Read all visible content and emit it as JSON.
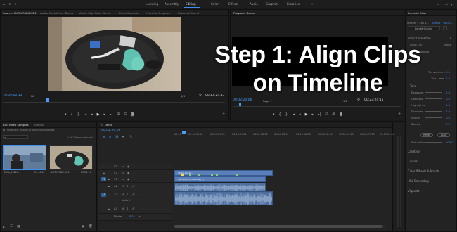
{
  "workspaces": {
    "tabs": [
      "Learning",
      "Assembly",
      "Editing",
      "Color",
      "Effects",
      "Audio",
      "Graphics",
      "Libraries"
    ],
    "active": "Editing"
  },
  "source_panel": {
    "tabs": [
      "Source: 4NT8478DK.MP4",
      "Audio Track Mixer: Demo",
      "Audio Clip Mixer: Demo",
      "Effect Controls",
      "Essential Graphics",
      "Essential Sound"
    ],
    "timecode_left": "16:59:00:13",
    "fit": "Fit",
    "timecode_right": "00:23:24:15",
    "scale": "1/8"
  },
  "program_panel": {
    "tab": "Program: Demo",
    "timecode_left": "00:02:20:06",
    "page": "Page 1",
    "fraction": "1/2",
    "timecode_right": "00:23:24:15"
  },
  "overlay": {
    "line1": "Step 1: Align Clips",
    "line2": "on Timeline"
  },
  "lumetri": {
    "title": "Lumetri Color",
    "master": "Master * 4NT8...",
    "sequence": "Demo * 4NT8...",
    "preset": "Lumetri Color",
    "basic_correction": "Basic Correction",
    "input_lut": "Input LUT",
    "input_lut_value": "None",
    "white_balance": "White Balance",
    "tone": "Tone",
    "rows": [
      {
        "label": "Temperature",
        "value": "0.0"
      },
      {
        "label": "Tint",
        "value": "0.0"
      },
      {
        "label": "Exposure",
        "value": "0.0"
      },
      {
        "label": "Contrast",
        "value": "0.0"
      },
      {
        "label": "Highlights",
        "value": "0.0"
      },
      {
        "label": "Shadows",
        "value": "0.0"
      },
      {
        "label": "Whites",
        "value": "0.0"
      },
      {
        "label": "Blacks",
        "value": "0.0"
      }
    ],
    "reset": "Reset",
    "auto": "Auto",
    "saturation_label": "Saturation",
    "saturation_value": "100.0",
    "sections": [
      "Creative",
      "Curves",
      "Color Wheels & Match",
      "HSL Secondary",
      "Vignette"
    ]
  },
  "project_panel": {
    "tabs": [
      "Bin: Video Samples",
      "Effects"
    ],
    "path": "Multi-cam tutorial.prproj\\Video Samples",
    "count": "1 of 2 items selected",
    "items": [
      {
        "name": "4KGb_20220...",
        "duration": "21:46:21"
      },
      {
        "name": "4NT8478DK.MP4",
        "duration": "23:24:15"
      }
    ]
  },
  "timeline": {
    "tab": "Demo",
    "timecode": "00:02:20:06",
    "ruler": [
      "00:00",
      "00:04:59:16",
      "00:09:59:09",
      "00:14:59:02",
      "00:19:58:23",
      "00:24:58:12",
      "00:29:58:08",
      "00:34:58:01",
      "00:39:57:20",
      "00:44:57:13",
      "00:49:57:06"
    ],
    "video_tracks": [
      "V3",
      "V2",
      "V1"
    ],
    "audio_tracks": [
      "A1",
      "A2",
      "A3"
    ],
    "source_patch_v": "V1",
    "source_patch_a": "A1",
    "audio_sublabel": "Audio 2",
    "master_label": "Master",
    "master_value": "0.0",
    "clip_v2": "4KGb_20220...",
    "clip_v1": "4NTS_2021_DSRfmw [V]"
  },
  "colors": {
    "accent": "#3e8ff0",
    "video_clip": "#5b7fb9",
    "audio_clip": "#4e6e9d",
    "playhead": "#4a9cf4"
  }
}
